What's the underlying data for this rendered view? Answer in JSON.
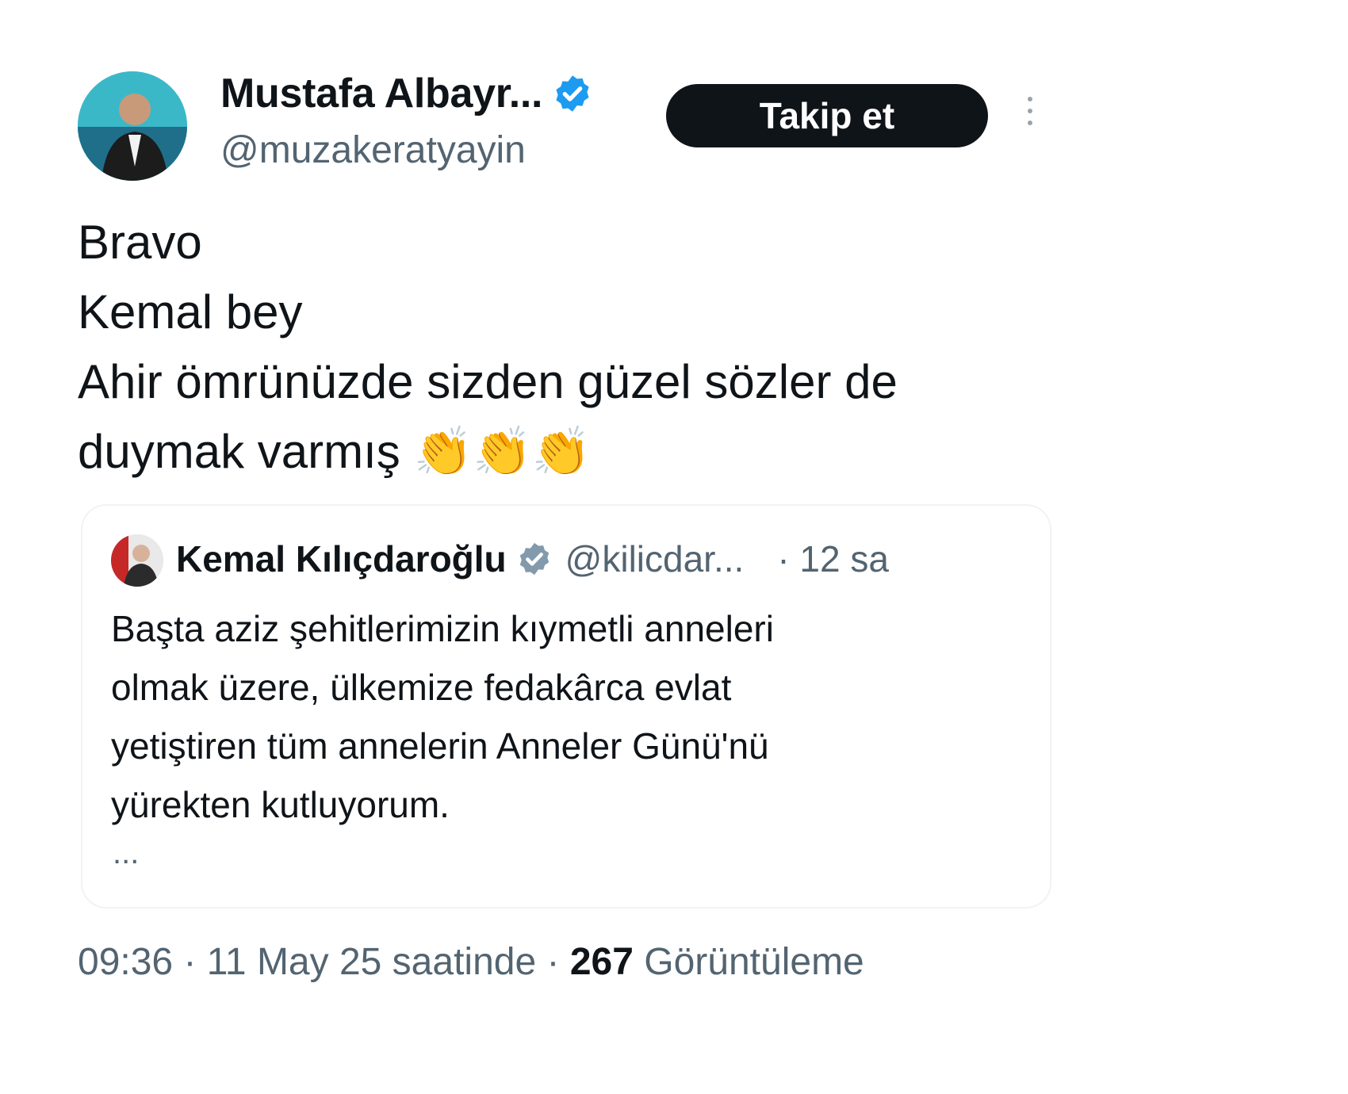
{
  "author": {
    "name": "Mustafa Albayr...",
    "handle": "@muzakeratyayin",
    "verified": true,
    "avatar_icon": "user-avatar"
  },
  "follow_button": {
    "label": "Takip et"
  },
  "more_icon": "more-vertical-icon",
  "tweet_text": [
    "Bravo",
    "Kemal bey",
    "Ahir ömrünüzde sizden güzel sözler de",
    "duymak varmış"
  ],
  "tweet_emoji": "👏👏👏",
  "quoted": {
    "name": "Kemal Kılıçdaroğlu",
    "handle": "@kilicdar...",
    "time": "· 12 sa",
    "verified": true,
    "text": [
      "Başta aziz şehitlerimizin kıymetli anneleri",
      "olmak üzere, ülkemize fedakârca evlat",
      "yetiştiren tüm annelerin Anneler Günü'nü",
      "yürekten kutluyorum."
    ],
    "more": "..."
  },
  "meta": {
    "time_date": "09:36 · 11 May 25 saatinde ·",
    "views_count": "267",
    "views_label": "Görüntüleme"
  },
  "colors": {
    "accent_blue": "#1d9bf0",
    "text_primary": "#0f1419",
    "text_secondary": "#536471",
    "button_bg": "#0f1419"
  }
}
